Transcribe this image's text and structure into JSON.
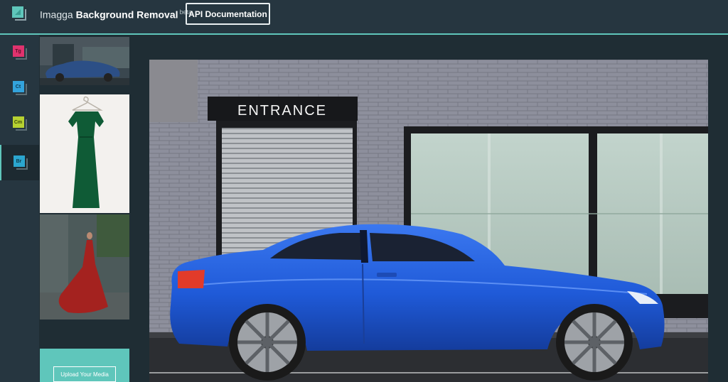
{
  "header": {
    "app_title_pre": "Imagga",
    "app_title_bold": "Background Removal",
    "app_title_badge": "beta",
    "api_button_label": "API Documentation"
  },
  "rail": {
    "items": [
      {
        "label": "Tg",
        "color": "#e0336e",
        "text_color": "#5b0d29"
      },
      {
        "label": "Ct",
        "color": "#33a3dc",
        "text_color": "#0d3a52"
      },
      {
        "label": "Cm",
        "color": "#b7d131",
        "text_color": "#3c4a0a"
      },
      {
        "label": "Br",
        "color": "#2ba6cf",
        "text_color": "#0c3a4b",
        "active": true
      }
    ]
  },
  "thumbnails": [
    {
      "subject": "blue car"
    },
    {
      "subject": "green dress on hanger",
      "selected": true
    },
    {
      "subject": "woman in red dress"
    }
  ],
  "upload": {
    "button_label": "Upload Your Media"
  },
  "preview": {
    "sign_text": "ENTRANCE",
    "subject": "blue coupe parked in front of brick building"
  },
  "colors": {
    "accent": "#5fc6bb",
    "header_bg": "#263640",
    "page_bg": "#1f2d34",
    "car_blue": "#1f5ad8"
  }
}
